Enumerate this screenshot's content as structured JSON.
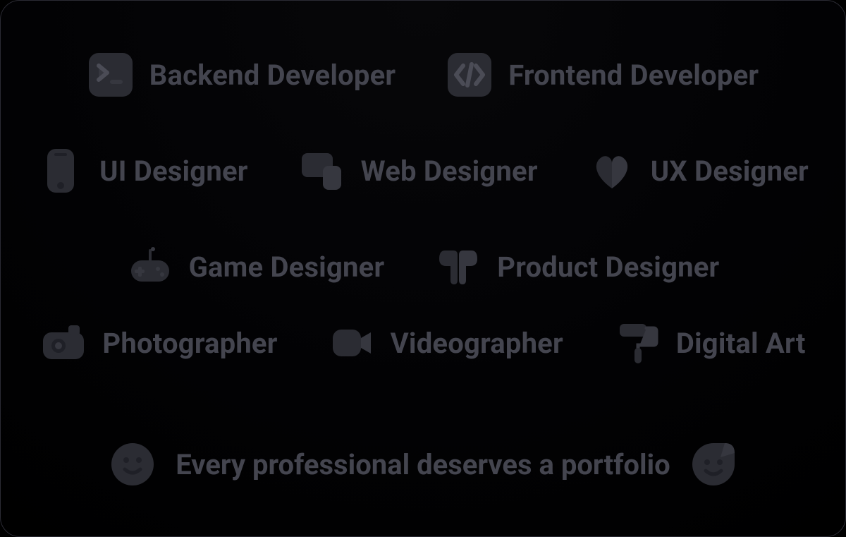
{
  "rows": [
    {
      "items": [
        "Backend Developer",
        "Frontend Developer"
      ]
    },
    {
      "items": [
        "UI Designer",
        "Web Designer",
        "UX Designer"
      ]
    },
    {
      "items": [
        "Game Designer",
        "Product Designer"
      ]
    },
    {
      "items": [
        "Photographer",
        "Videographer",
        "Digital Art"
      ]
    }
  ],
  "footer": {
    "text": "Every professional deserves a portfolio"
  },
  "colors": {
    "text": "#44454f",
    "icon_dark": "#2b2c33",
    "icon_light": "#36373f",
    "border": "#2b2b34",
    "bg": "#020204"
  }
}
